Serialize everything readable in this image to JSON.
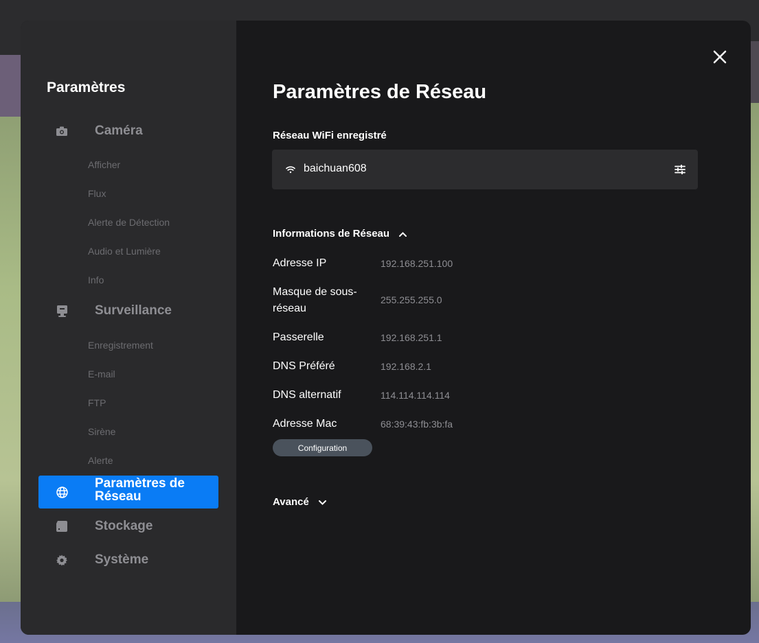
{
  "sidebar": {
    "title": "Paramètres",
    "sections": [
      {
        "label": "Caméra",
        "icon": "camera-icon",
        "items": [
          "Afficher",
          "Flux",
          "Alerte de Détection",
          "Audio et Lumière",
          "Info"
        ]
      },
      {
        "label": "Surveillance",
        "icon": "monitor-icon",
        "items": [
          "Enregistrement",
          "E-mail",
          "FTP",
          "Sirène",
          "Alerte"
        ]
      },
      {
        "label": "Paramètres de Réseau",
        "icon": "globe-icon",
        "active": true,
        "items": []
      },
      {
        "label": "Stockage",
        "icon": "storage-icon",
        "items": []
      },
      {
        "label": "Système",
        "icon": "gear-icon",
        "items": []
      }
    ],
    "active_color": "#0a7cf5"
  },
  "main": {
    "title": "Paramètres de Réseau",
    "wifi": {
      "heading": "Réseau WiFi enregistré",
      "ssid": "baichuan608",
      "icon": "wifi-icon",
      "action_icon": "settings-sliders-icon"
    },
    "network_info": {
      "heading": "Informations de Réseau",
      "expanded": true,
      "rows": [
        {
          "key": "Adresse IP",
          "value": "192.168.251.100"
        },
        {
          "key": "Masque de sous-réseau",
          "value": "255.255.255.0"
        },
        {
          "key": "Passerelle",
          "value": "192.168.251.1"
        },
        {
          "key": "DNS Préféré",
          "value": "192.168.2.1"
        },
        {
          "key": "DNS alternatif",
          "value": "114.114.114.114"
        },
        {
          "key": "Adresse Mac",
          "value": "68:39:43:fb:3b:fa"
        }
      ],
      "config_button": "Configuration"
    },
    "advanced": {
      "heading": "Avancé",
      "expanded": false
    }
  }
}
